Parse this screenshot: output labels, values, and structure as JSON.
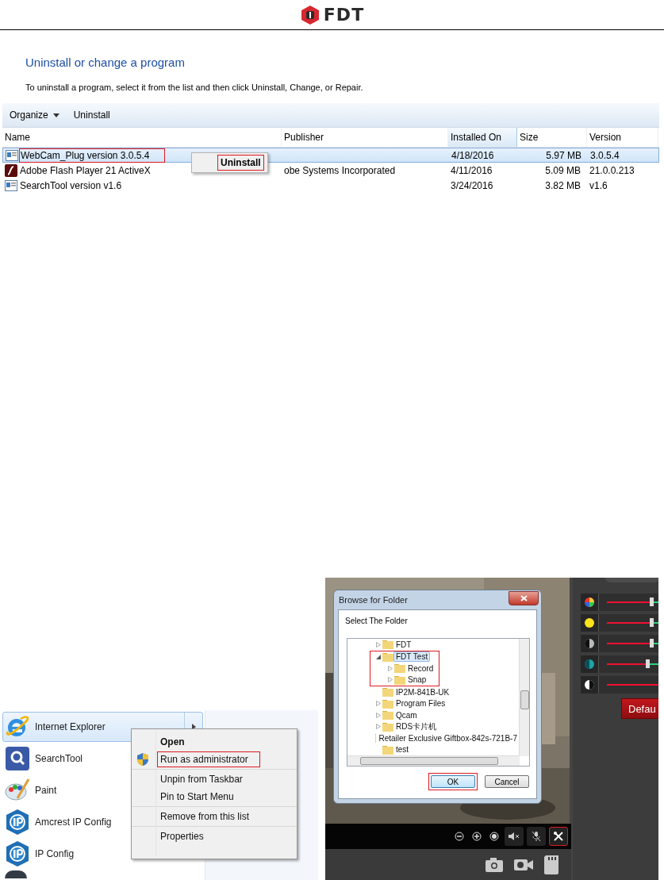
{
  "header": {
    "logo": "FDT"
  },
  "control_panel": {
    "title": "Uninstall or change a program",
    "description": "To uninstall a program, select it from the list and then click Uninstall, Change, or Repair.",
    "toolbar": [
      {
        "label": "Organize",
        "kind": "dropdown"
      },
      {
        "label": "Uninstall",
        "kind": "button"
      }
    ],
    "columns": [
      {
        "label": "Name",
        "selected": false
      },
      {
        "label": "Publisher",
        "selected": false
      },
      {
        "label": "Installed On",
        "selected": true
      },
      {
        "label": "Size",
        "selected": false
      },
      {
        "label": "Version",
        "selected": false
      }
    ],
    "rows": [
      {
        "cells": [
          "WebCam_Plug version 3.0.5.4",
          "",
          "4/18/2016",
          "5.97 MB",
          "3.0.5.4"
        ],
        "selected": true,
        "marked": true
      },
      {
        "cells": [
          "Adobe Flash Player 21 ActiveX",
          "obe Systems Incorporated",
          "4/11/2016",
          "5.09 MB",
          "21.0.0.213"
        ],
        "selected": false,
        "marked": false
      },
      {
        "cells": [
          "SearchTool version v1.6",
          "",
          "3/24/2016",
          "3.82 MB",
          "v1.6"
        ],
        "selected": false,
        "marked": false
      }
    ],
    "context_menu": {
      "items": [
        {
          "label": "Uninstall",
          "marked": true
        }
      ]
    }
  },
  "start_menu": {
    "items": [
      {
        "label": "Internet Explorer",
        "selected": true
      },
      {
        "label": "SearchTool",
        "selected": false
      },
      {
        "label": "Paint",
        "selected": false
      },
      {
        "label": "Amcrest IP Config",
        "selected": false
      },
      {
        "label": "IP Config",
        "selected": false
      }
    ],
    "context_menu": {
      "sections": [
        [
          {
            "label": "Open",
            "kind": "default",
            "marked": false
          },
          {
            "label": "Run as administrator",
            "kind": "admin",
            "marked": true
          }
        ],
        [
          {
            "label": "Unpin from Taskbar",
            "kind": "plain",
            "marked": false
          },
          {
            "label": "Pin to Start Menu",
            "kind": "plain",
            "marked": false
          }
        ],
        [
          {
            "label": "Remove from this list",
            "kind": "plain",
            "marked": false
          }
        ],
        [
          {
            "label": "Properties",
            "kind": "plain",
            "marked": false
          }
        ]
      ]
    }
  },
  "camera_app": {
    "dialog": {
      "title": "Browse for Folder",
      "prompt": "Select The Folder",
      "tree": [
        {
          "label": "FDT",
          "expandable": true,
          "expanded": false,
          "selected": false,
          "marked": false
        },
        {
          "label": "FDT Test",
          "expandable": true,
          "expanded": true,
          "selected": true,
          "marked": true,
          "children": [
            {
              "label": "Record",
              "expandable": true,
              "expanded": false,
              "selected": false,
              "marked": false
            },
            {
              "label": "Snap",
              "expandable": true,
              "expanded": false,
              "selected": false,
              "marked": false
            }
          ]
        },
        {
          "label": "IP2M-841B-UK",
          "expandable": false,
          "selected": false,
          "marked": false
        },
        {
          "label": "Program Files",
          "expandable": true,
          "expanded": false,
          "selected": false,
          "marked": false
        },
        {
          "label": "Qcam",
          "expandable": true,
          "expanded": false,
          "selected": false,
          "marked": false
        },
        {
          "label": "RDS卡片机",
          "expandable": true,
          "expanded": false,
          "selected": false,
          "marked": false
        },
        {
          "label": "Retailer Exclusive Giftbox-842s-721B-7",
          "expandable": false,
          "selected": false,
          "marked": false
        },
        {
          "label": "test",
          "expandable": false,
          "selected": false,
          "marked": false
        }
      ],
      "buttons": [
        {
          "label": "OK",
          "default": true,
          "marked": true
        },
        {
          "label": "Cancel",
          "default": false,
          "marked": false
        }
      ]
    },
    "sliders": [
      {
        "kind": "color",
        "level": 0.86
      },
      {
        "kind": "brightness",
        "level": 0.86
      },
      {
        "kind": "contrast",
        "level": 0.86
      },
      {
        "kind": "saturation",
        "level": 0.78
      },
      {
        "kind": "sharpness",
        "level": 1
      }
    ],
    "default_button": "Defau",
    "tools": [
      {
        "kind": "zoom-out",
        "marked": false
      },
      {
        "kind": "zoom-in",
        "marked": false
      },
      {
        "kind": "record",
        "marked": false
      },
      {
        "kind": "mute",
        "marked": false
      },
      {
        "kind": "mic-off",
        "marked": false
      },
      {
        "kind": "settings",
        "marked": true
      }
    ],
    "capture_tools": [
      {
        "kind": "snapshot"
      },
      {
        "kind": "video"
      },
      {
        "kind": "sd-card"
      }
    ]
  }
}
